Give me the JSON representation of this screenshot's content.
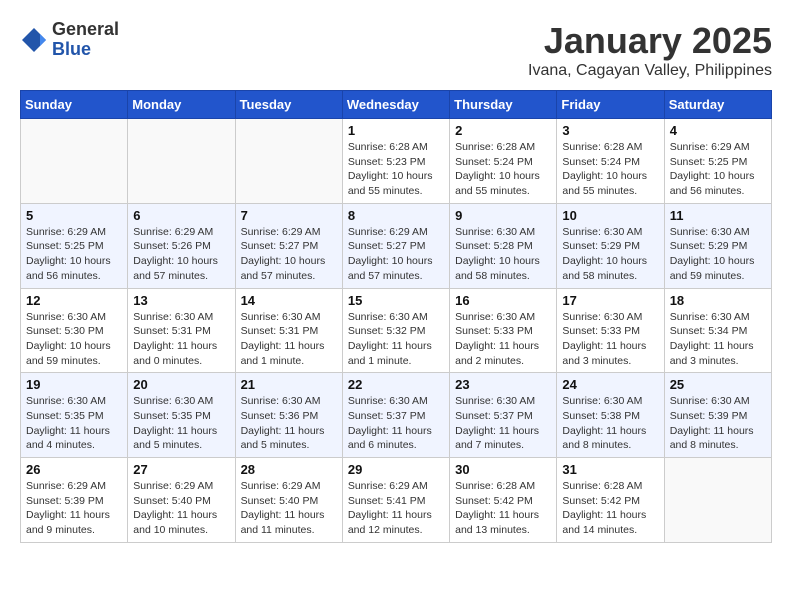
{
  "logo": {
    "general": "General",
    "blue": "Blue"
  },
  "header": {
    "title": "January 2025",
    "subtitle": "Ivana, Cagayan Valley, Philippines"
  },
  "days_of_week": [
    "Sunday",
    "Monday",
    "Tuesday",
    "Wednesday",
    "Thursday",
    "Friday",
    "Saturday"
  ],
  "weeks": [
    [
      {
        "day": "",
        "info": ""
      },
      {
        "day": "",
        "info": ""
      },
      {
        "day": "",
        "info": ""
      },
      {
        "day": "1",
        "info": "Sunrise: 6:28 AM\nSunset: 5:23 PM\nDaylight: 10 hours\nand 55 minutes."
      },
      {
        "day": "2",
        "info": "Sunrise: 6:28 AM\nSunset: 5:24 PM\nDaylight: 10 hours\nand 55 minutes."
      },
      {
        "day": "3",
        "info": "Sunrise: 6:28 AM\nSunset: 5:24 PM\nDaylight: 10 hours\nand 55 minutes."
      },
      {
        "day": "4",
        "info": "Sunrise: 6:29 AM\nSunset: 5:25 PM\nDaylight: 10 hours\nand 56 minutes."
      }
    ],
    [
      {
        "day": "5",
        "info": "Sunrise: 6:29 AM\nSunset: 5:25 PM\nDaylight: 10 hours\nand 56 minutes."
      },
      {
        "day": "6",
        "info": "Sunrise: 6:29 AM\nSunset: 5:26 PM\nDaylight: 10 hours\nand 57 minutes."
      },
      {
        "day": "7",
        "info": "Sunrise: 6:29 AM\nSunset: 5:27 PM\nDaylight: 10 hours\nand 57 minutes."
      },
      {
        "day": "8",
        "info": "Sunrise: 6:29 AM\nSunset: 5:27 PM\nDaylight: 10 hours\nand 57 minutes."
      },
      {
        "day": "9",
        "info": "Sunrise: 6:30 AM\nSunset: 5:28 PM\nDaylight: 10 hours\nand 58 minutes."
      },
      {
        "day": "10",
        "info": "Sunrise: 6:30 AM\nSunset: 5:29 PM\nDaylight: 10 hours\nand 58 minutes."
      },
      {
        "day": "11",
        "info": "Sunrise: 6:30 AM\nSunset: 5:29 PM\nDaylight: 10 hours\nand 59 minutes."
      }
    ],
    [
      {
        "day": "12",
        "info": "Sunrise: 6:30 AM\nSunset: 5:30 PM\nDaylight: 10 hours\nand 59 minutes."
      },
      {
        "day": "13",
        "info": "Sunrise: 6:30 AM\nSunset: 5:31 PM\nDaylight: 11 hours\nand 0 minutes."
      },
      {
        "day": "14",
        "info": "Sunrise: 6:30 AM\nSunset: 5:31 PM\nDaylight: 11 hours\nand 1 minute."
      },
      {
        "day": "15",
        "info": "Sunrise: 6:30 AM\nSunset: 5:32 PM\nDaylight: 11 hours\nand 1 minute."
      },
      {
        "day": "16",
        "info": "Sunrise: 6:30 AM\nSunset: 5:33 PM\nDaylight: 11 hours\nand 2 minutes."
      },
      {
        "day": "17",
        "info": "Sunrise: 6:30 AM\nSunset: 5:33 PM\nDaylight: 11 hours\nand 3 minutes."
      },
      {
        "day": "18",
        "info": "Sunrise: 6:30 AM\nSunset: 5:34 PM\nDaylight: 11 hours\nand 3 minutes."
      }
    ],
    [
      {
        "day": "19",
        "info": "Sunrise: 6:30 AM\nSunset: 5:35 PM\nDaylight: 11 hours\nand 4 minutes."
      },
      {
        "day": "20",
        "info": "Sunrise: 6:30 AM\nSunset: 5:35 PM\nDaylight: 11 hours\nand 5 minutes."
      },
      {
        "day": "21",
        "info": "Sunrise: 6:30 AM\nSunset: 5:36 PM\nDaylight: 11 hours\nand 5 minutes."
      },
      {
        "day": "22",
        "info": "Sunrise: 6:30 AM\nSunset: 5:37 PM\nDaylight: 11 hours\nand 6 minutes."
      },
      {
        "day": "23",
        "info": "Sunrise: 6:30 AM\nSunset: 5:37 PM\nDaylight: 11 hours\nand 7 minutes."
      },
      {
        "day": "24",
        "info": "Sunrise: 6:30 AM\nSunset: 5:38 PM\nDaylight: 11 hours\nand 8 minutes."
      },
      {
        "day": "25",
        "info": "Sunrise: 6:30 AM\nSunset: 5:39 PM\nDaylight: 11 hours\nand 8 minutes."
      }
    ],
    [
      {
        "day": "26",
        "info": "Sunrise: 6:29 AM\nSunset: 5:39 PM\nDaylight: 11 hours\nand 9 minutes."
      },
      {
        "day": "27",
        "info": "Sunrise: 6:29 AM\nSunset: 5:40 PM\nDaylight: 11 hours\nand 10 minutes."
      },
      {
        "day": "28",
        "info": "Sunrise: 6:29 AM\nSunset: 5:40 PM\nDaylight: 11 hours\nand 11 minutes."
      },
      {
        "day": "29",
        "info": "Sunrise: 6:29 AM\nSunset: 5:41 PM\nDaylight: 11 hours\nand 12 minutes."
      },
      {
        "day": "30",
        "info": "Sunrise: 6:28 AM\nSunset: 5:42 PM\nDaylight: 11 hours\nand 13 minutes."
      },
      {
        "day": "31",
        "info": "Sunrise: 6:28 AM\nSunset: 5:42 PM\nDaylight: 11 hours\nand 14 minutes."
      },
      {
        "day": "",
        "info": ""
      }
    ]
  ]
}
